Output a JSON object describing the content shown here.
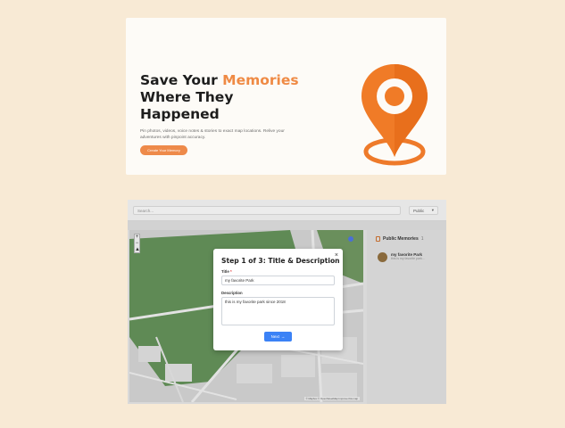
{
  "hero": {
    "title_part1": "Save Your ",
    "title_accent": "Memories",
    "title_part2": "Where They Happened",
    "description": "Pin photos, videos, voice notes & stories to exact map locations. Relive your adventures with pinpoint accuracy.",
    "cta_label": "Create Your Memory",
    "accent_color": "#ef8a44",
    "illustration_icon": "map-pin-icon"
  },
  "app": {
    "search_placeholder": "Search...",
    "privacy_value": "Public",
    "map_zoom_in": "+",
    "map_zoom_out": "−",
    "map_attribution": "© Mapbox © OpenStreetMap  Improve this map",
    "sidebar": {
      "heading": "Public Memories",
      "count": "1",
      "items": [
        {
          "title": "my favorite Park",
          "subtitle": "this is my favorite park..."
        }
      ]
    }
  },
  "modal": {
    "title": "Step 1 of 3: Title & Description",
    "close_label": "×",
    "title_label": "Title",
    "title_required": "*",
    "title_value": "my favorite Park",
    "description_label": "Description",
    "description_value": "this is my favorite park since 2018",
    "next_label": "Next",
    "next_arrow": "→",
    "button_color": "#3b82f6"
  }
}
